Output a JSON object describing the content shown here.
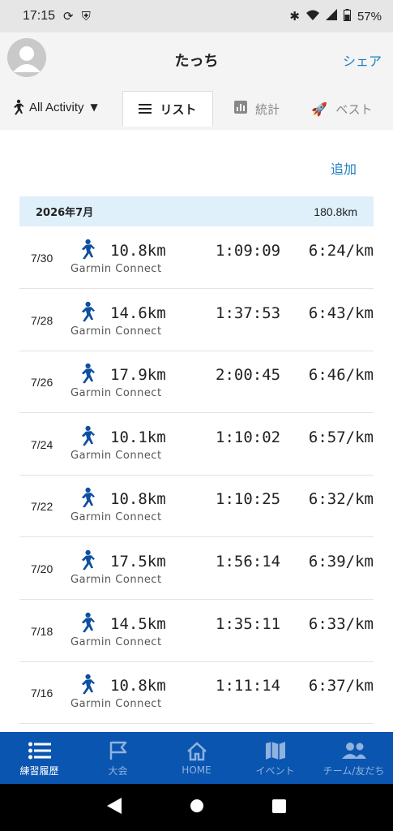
{
  "status": {
    "time": "17:15",
    "battery": "57%"
  },
  "header": {
    "title": "たっち",
    "share": "シェア"
  },
  "tabs": {
    "filter": "All Activity",
    "list": "リスト",
    "stats": "統計",
    "best": "ベスト"
  },
  "actions": {
    "add": "追加"
  },
  "month": {
    "label": "2026年7月",
    "total": "180.8km"
  },
  "activities": [
    {
      "date": "7/30",
      "distance": "10.8km",
      "source": "Garmin Connect",
      "duration": "1:09:09",
      "pace": "6:24/km"
    },
    {
      "date": "7/28",
      "distance": "14.6km",
      "source": "Garmin Connect",
      "duration": "1:37:53",
      "pace": "6:43/km"
    },
    {
      "date": "7/26",
      "distance": "17.9km",
      "source": "Garmin Connect",
      "duration": "2:00:45",
      "pace": "6:46/km"
    },
    {
      "date": "7/24",
      "distance": "10.1km",
      "source": "Garmin Connect",
      "duration": "1:10:02",
      "pace": "6:57/km"
    },
    {
      "date": "7/22",
      "distance": "10.8km",
      "source": "Garmin Connect",
      "duration": "1:10:25",
      "pace": "6:32/km"
    },
    {
      "date": "7/20",
      "distance": "17.5km",
      "source": "Garmin Connect",
      "duration": "1:56:14",
      "pace": "6:39/km"
    },
    {
      "date": "7/18",
      "distance": "14.5km",
      "source": "Garmin Connect",
      "duration": "1:35:11",
      "pace": "6:33/km"
    },
    {
      "date": "7/16",
      "distance": "10.8km",
      "source": "Garmin Connect",
      "duration": "1:11:14",
      "pace": "6:37/km"
    }
  ],
  "nav": {
    "history": "練習履歴",
    "race": "大会",
    "home": "HOME",
    "event": "イベント",
    "team": "チーム/友だち"
  },
  "colors": {
    "accent": "#1a7fc1",
    "nav_bg": "#0a55b0",
    "month_bg": "#dff0fb"
  }
}
